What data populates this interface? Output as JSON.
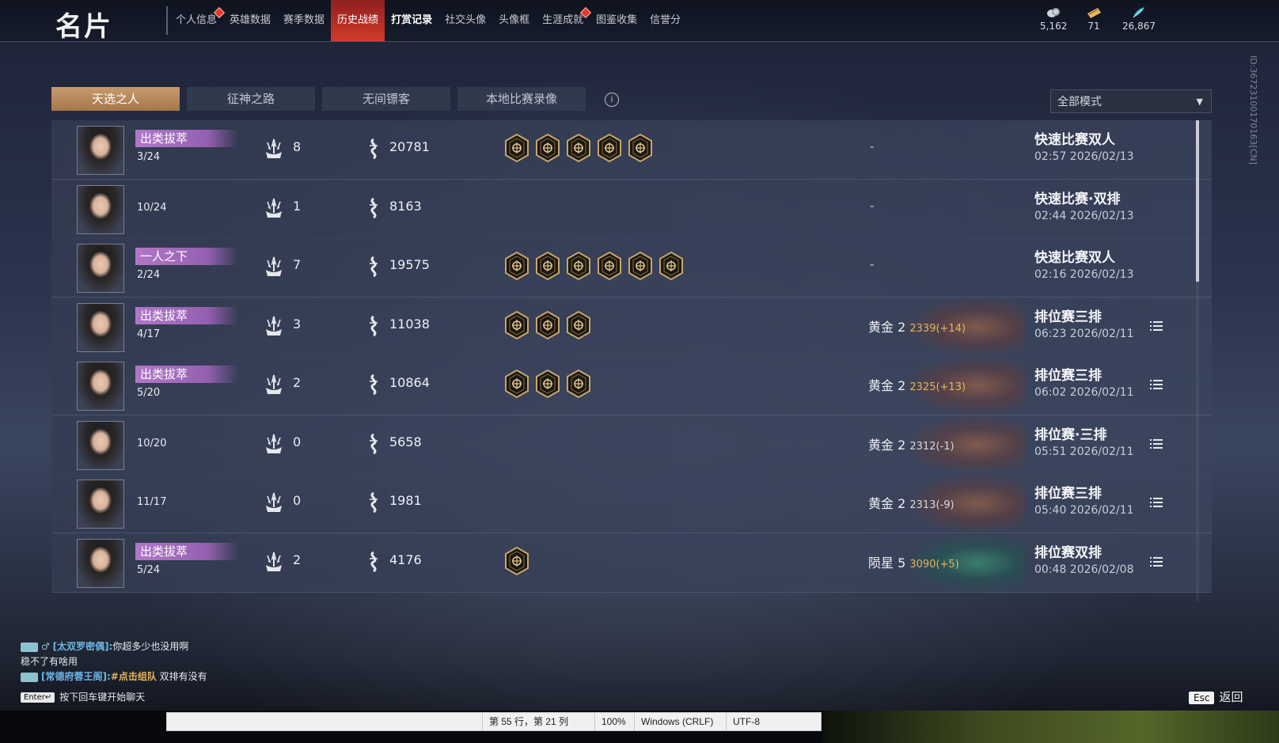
{
  "app": {
    "title": "名片"
  },
  "nav": {
    "tabs": [
      {
        "label": "个人信息",
        "dot": true
      },
      {
        "label": "英雄数据"
      },
      {
        "label": "赛季数据"
      },
      {
        "label": "历史战绩",
        "active": true
      },
      {
        "label": "打赏记录",
        "bold": true
      },
      {
        "label": "社交头像"
      },
      {
        "label": "头像框"
      },
      {
        "label": "生涯成就",
        "dot": true
      },
      {
        "label": "图鉴收集"
      },
      {
        "label": "信誉分"
      }
    ]
  },
  "currencies": [
    {
      "icon": "coin-stack-icon",
      "value": "5,162"
    },
    {
      "icon": "ticket-icon",
      "value": "71"
    },
    {
      "icon": "feather-crystal-icon",
      "value": "26,867"
    }
  ],
  "player_id": "ID:3672310017016​3[CN]",
  "subtabs": [
    {
      "label": "天选之人",
      "active": true
    },
    {
      "label": "征神之路"
    },
    {
      "label": "无间镖客"
    },
    {
      "label": "本地比赛录像"
    }
  ],
  "mode_filter": {
    "selected": "全部模式"
  },
  "matches": [
    {
      "title": "出类拔萃",
      "rank": "3/24",
      "kills": "8",
      "score": "20781",
      "badges": [
        "mask-badge-icon",
        "serpent-badge-icon",
        "sigil-badge-icon",
        "star-badge-icon",
        "peak-badge-icon"
      ],
      "tier": "",
      "tier_delta": "",
      "mode": "快速比赛双人",
      "time": "02:57  2026/02/13",
      "has_detail": false
    },
    {
      "title": "",
      "rank": "10/24",
      "kills": "1",
      "score": "8163",
      "badges": [],
      "tier": "",
      "tier_delta": "",
      "mode": "快速比赛·双排",
      "time": "02:44  2026/02/13",
      "has_detail": false
    },
    {
      "title": "一人之下",
      "rank": "2/24",
      "kills": "7",
      "score": "19575",
      "badges": [
        "mask-badge-icon",
        "serpent-badge-icon",
        "wave-badge-icon",
        "sigil-badge-icon",
        "crown-badge-icon",
        "star-badge-icon"
      ],
      "tier": "",
      "tier_delta": "",
      "mode": "快速比赛双人",
      "time": "02:16  2026/02/13",
      "has_detail": false
    },
    {
      "title": "出类拔萃",
      "rank": "4/17",
      "kills": "3",
      "score": "11038",
      "badges": [
        "dragon-badge-icon",
        "star-badge-icon",
        "flame-badge-icon"
      ],
      "tier": "黄金 2",
      "tier_delta": "2339(+14)",
      "mode": "排位赛三排",
      "time": "06:23  2026/02/11",
      "has_detail": true
    },
    {
      "title": "出类拔萃",
      "rank": "5/20",
      "kills": "2",
      "score": "10864",
      "badges": [
        "dragon-badge-icon",
        "flame-badge-icon",
        "wing-badge-icon"
      ],
      "tier": "黄金 2",
      "tier_delta": "2325(+13)",
      "mode": "排位赛三排",
      "time": "06:02  2026/02/11",
      "has_detail": true
    },
    {
      "title": "",
      "rank": "10/20",
      "kills": "0",
      "score": "5658",
      "badges": [],
      "tier": "黄金 2",
      "tier_delta": "2312(-1)",
      "mode": "排位赛·三排",
      "time": "05:51  2026/02/11",
      "has_detail": true
    },
    {
      "title": "",
      "rank": "11/17",
      "kills": "0",
      "score": "1981",
      "badges": [],
      "tier": "黄金 2",
      "tier_delta": "2313(-9)",
      "mode": "排位赛三排",
      "time": "05:40  2026/02/11",
      "has_detail": true
    },
    {
      "title": "出类拔萃",
      "rank": "5/24",
      "kills": "2",
      "score": "4176",
      "badges": [
        "dragon-badge-icon"
      ],
      "tier": "陨星 5",
      "tier_delta": "3090(+5)",
      "mode": "排位赛双排",
      "time": "00:48  2026/02/08",
      "has_detail": true
    }
  ],
  "chat": {
    "line1_name": "[太双罗密偶]:",
    "line1_msg": "你超多少也没用啊",
    "line2_msg": "稳不了有啥用",
    "line3_name": "[常德府蓉王阁]:",
    "line3_link": "#点击组队",
    "line3_msg": " 双排有没有",
    "enter_key": "Enter↵",
    "prompt": "按下回车键开始聊天"
  },
  "esc": {
    "key": "Esc",
    "label": "返回"
  },
  "statusbar": {
    "position": "第 55 行，第 21 列",
    "zoom": "100%",
    "eol": "Windows (CRLF)",
    "encoding": "UTF-8"
  }
}
